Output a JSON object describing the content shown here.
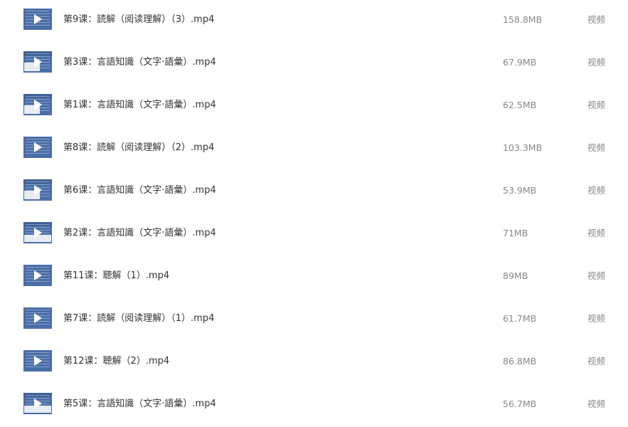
{
  "files": [
    {
      "name": "第9课：読解（阅读理解）（3）.mp4",
      "size": "158.8MB",
      "type": "视频",
      "thumbnail": "text-slide"
    },
    {
      "name": "第3课：言語知識（文字·語彙）.mp4",
      "size": "67.9MB",
      "type": "视频",
      "thumbnail": "slide-with-pane"
    },
    {
      "name": "第1课：言語知識（文字·語彙）.mp4",
      "size": "62.5MB",
      "type": "视频",
      "thumbnail": "slide-with-pane"
    },
    {
      "name": "第8课：読解（阅读理解）（2）.mp4",
      "size": "103.3MB",
      "type": "视频",
      "thumbnail": "text-slide"
    },
    {
      "name": "第6课：言語知識（文字·語彙）.mp4",
      "size": "53.9MB",
      "type": "视频",
      "thumbnail": "slide-with-pane"
    },
    {
      "name": "第2课：言語知識（文字·語彙）.mp4",
      "size": "71MB",
      "type": "视频",
      "thumbnail": "slide-with-wide-pane"
    },
    {
      "name": "第11课：聴解（1）.mp4",
      "size": "89MB",
      "type": "视频",
      "thumbnail": "text-slide"
    },
    {
      "name": "第7课：読解（阅读理解）（1）.mp4",
      "size": "61.7MB",
      "type": "视频",
      "thumbnail": "text-slide"
    },
    {
      "name": "第12课：聴解（2）.mp4",
      "size": "86.8MB",
      "type": "视频",
      "thumbnail": "text-slide"
    },
    {
      "name": "第5课：言語知識（文字·語彙）.mp4",
      "size": "56.7MB",
      "type": "视频",
      "thumbnail": "slide-with-wide-pane"
    }
  ],
  "colors": {
    "thumbnail_bg": "#4a6ea8",
    "name_text": "#333333",
    "meta_text": "#888888"
  }
}
